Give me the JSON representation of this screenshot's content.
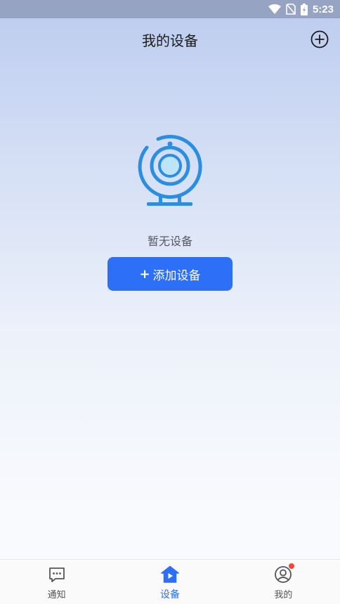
{
  "status_bar": {
    "time": "5:23",
    "icons": [
      "wifi-icon",
      "no-sim-icon",
      "battery-charging-icon"
    ]
  },
  "header": {
    "title": "我的设备",
    "action_icon": "add-circle-icon"
  },
  "empty_state": {
    "illustration_icon": "webcam-icon",
    "message": "暂无设备",
    "button_label": "添加设备",
    "button_prefix": "+"
  },
  "tabs": [
    {
      "label": "通知",
      "icon": "message-icon",
      "active": false
    },
    {
      "label": "设备",
      "icon": "home-play-icon",
      "active": true
    },
    {
      "label": "我的",
      "icon": "user-icon",
      "active": false,
      "badge": true
    }
  ],
  "colors": {
    "accent": "#2e6ff7",
    "illustration": "#2b8ee0",
    "badge": "#f2453d"
  }
}
